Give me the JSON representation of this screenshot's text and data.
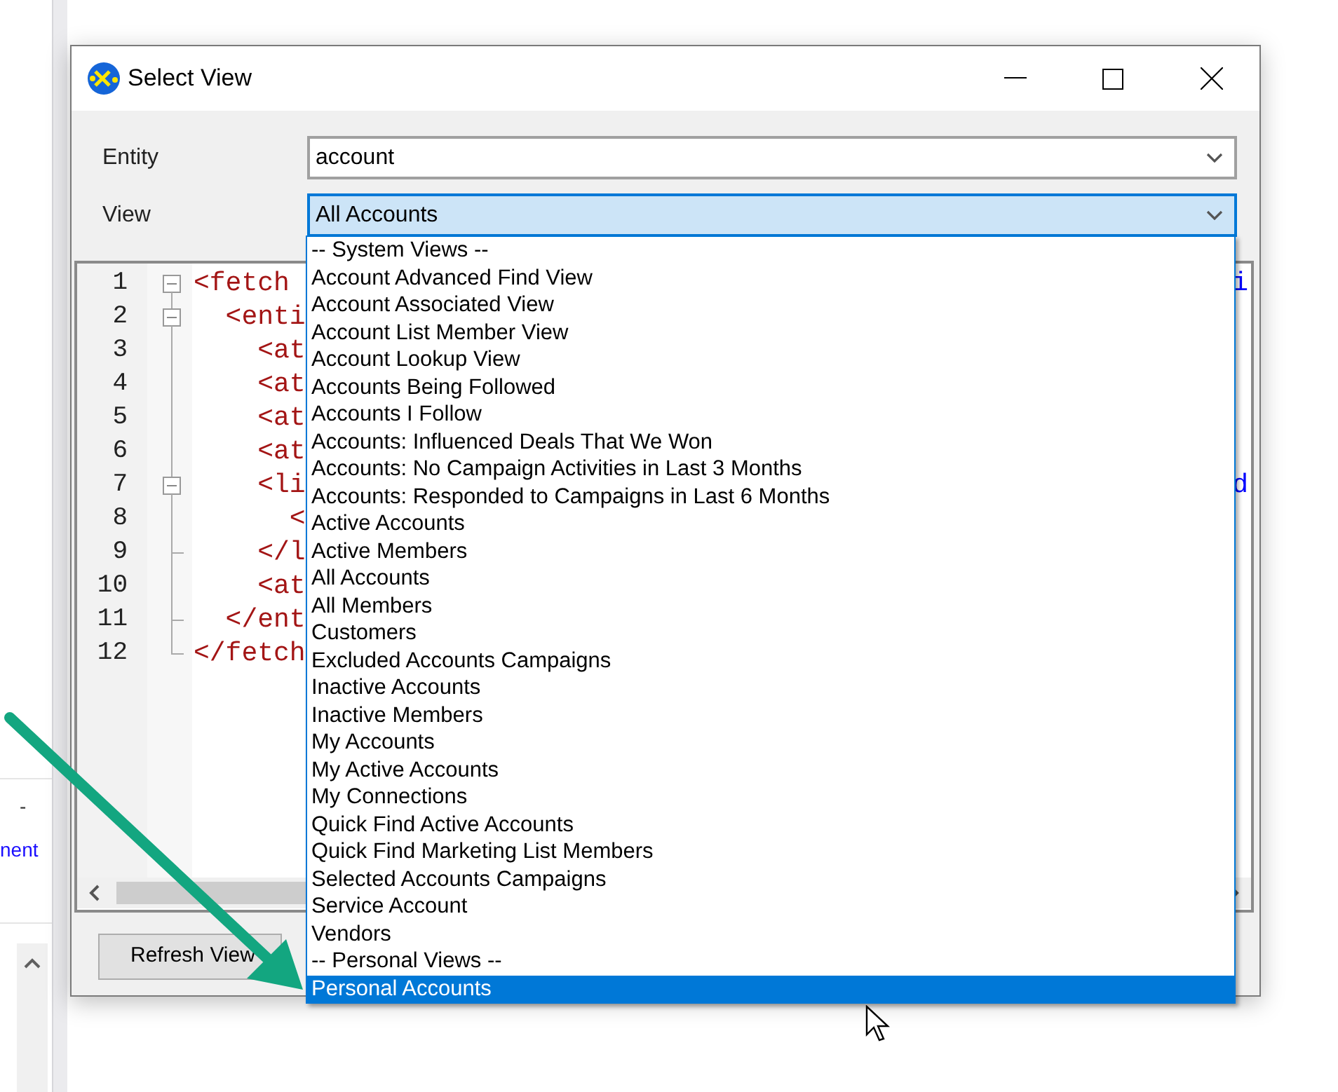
{
  "background": {
    "dash": "-",
    "link": "nent"
  },
  "dialog": {
    "title": "Select View",
    "fields": [
      {
        "label": "Entity",
        "value": "account",
        "focused": false
      },
      {
        "label": "View",
        "value": "All Accounts",
        "focused": true
      }
    ],
    "editor": {
      "lines": [
        {
          "number": "1",
          "text": "<fetch",
          "kind": "open",
          "tail": "i"
        },
        {
          "number": "2",
          "text": "  <enti",
          "kind": "open"
        },
        {
          "number": "3",
          "text": "    <at",
          "kind": "line"
        },
        {
          "number": "4",
          "text": "    <at",
          "kind": "line"
        },
        {
          "number": "5",
          "text": "    <at",
          "kind": "line"
        },
        {
          "number": "6",
          "text": "    <at",
          "kind": "line"
        },
        {
          "number": "7",
          "text": "    <li",
          "kind": "open",
          "tail": "d"
        },
        {
          "number": "8",
          "text": "      <",
          "kind": "line"
        },
        {
          "number": "9",
          "text": "    </l",
          "kind": "end"
        },
        {
          "number": "10",
          "text": "    <at",
          "kind": "line"
        },
        {
          "number": "11",
          "text": "  </ent",
          "kind": "end"
        },
        {
          "number": "12",
          "text": "</fetch",
          "kind": "last"
        }
      ]
    },
    "button": "Refresh View"
  },
  "dropdown": {
    "items": [
      {
        "label": "-- System Views --",
        "selected": false
      },
      {
        "label": "Account Advanced Find View",
        "selected": false
      },
      {
        "label": "Account Associated View",
        "selected": false
      },
      {
        "label": "Account List Member View",
        "selected": false
      },
      {
        "label": "Account Lookup View",
        "selected": false
      },
      {
        "label": "Accounts Being Followed",
        "selected": false
      },
      {
        "label": "Accounts I Follow",
        "selected": false
      },
      {
        "label": "Accounts: Influenced Deals That We Won",
        "selected": false
      },
      {
        "label": "Accounts: No Campaign Activities in Last 3 Months",
        "selected": false
      },
      {
        "label": "Accounts: Responded to Campaigns in Last 6 Months",
        "selected": false
      },
      {
        "label": "Active Accounts",
        "selected": false
      },
      {
        "label": "Active Members",
        "selected": false
      },
      {
        "label": "All Accounts",
        "selected": false
      },
      {
        "label": "All Members",
        "selected": false
      },
      {
        "label": "Customers",
        "selected": false
      },
      {
        "label": "Excluded Accounts Campaigns",
        "selected": false
      },
      {
        "label": "Inactive Accounts",
        "selected": false
      },
      {
        "label": "Inactive Members",
        "selected": false
      },
      {
        "label": "My Accounts",
        "selected": false
      },
      {
        "label": "My Active Accounts",
        "selected": false
      },
      {
        "label": "My Connections",
        "selected": false
      },
      {
        "label": "Quick Find Active Accounts",
        "selected": false
      },
      {
        "label": "Quick Find Marketing List Members",
        "selected": false
      },
      {
        "label": "Selected Accounts Campaigns",
        "selected": false
      },
      {
        "label": "Service Account",
        "selected": false
      },
      {
        "label": "Vendors",
        "selected": false
      },
      {
        "label": "-- Personal Views --",
        "selected": false
      },
      {
        "label": "Personal Accounts",
        "selected": true
      }
    ]
  }
}
